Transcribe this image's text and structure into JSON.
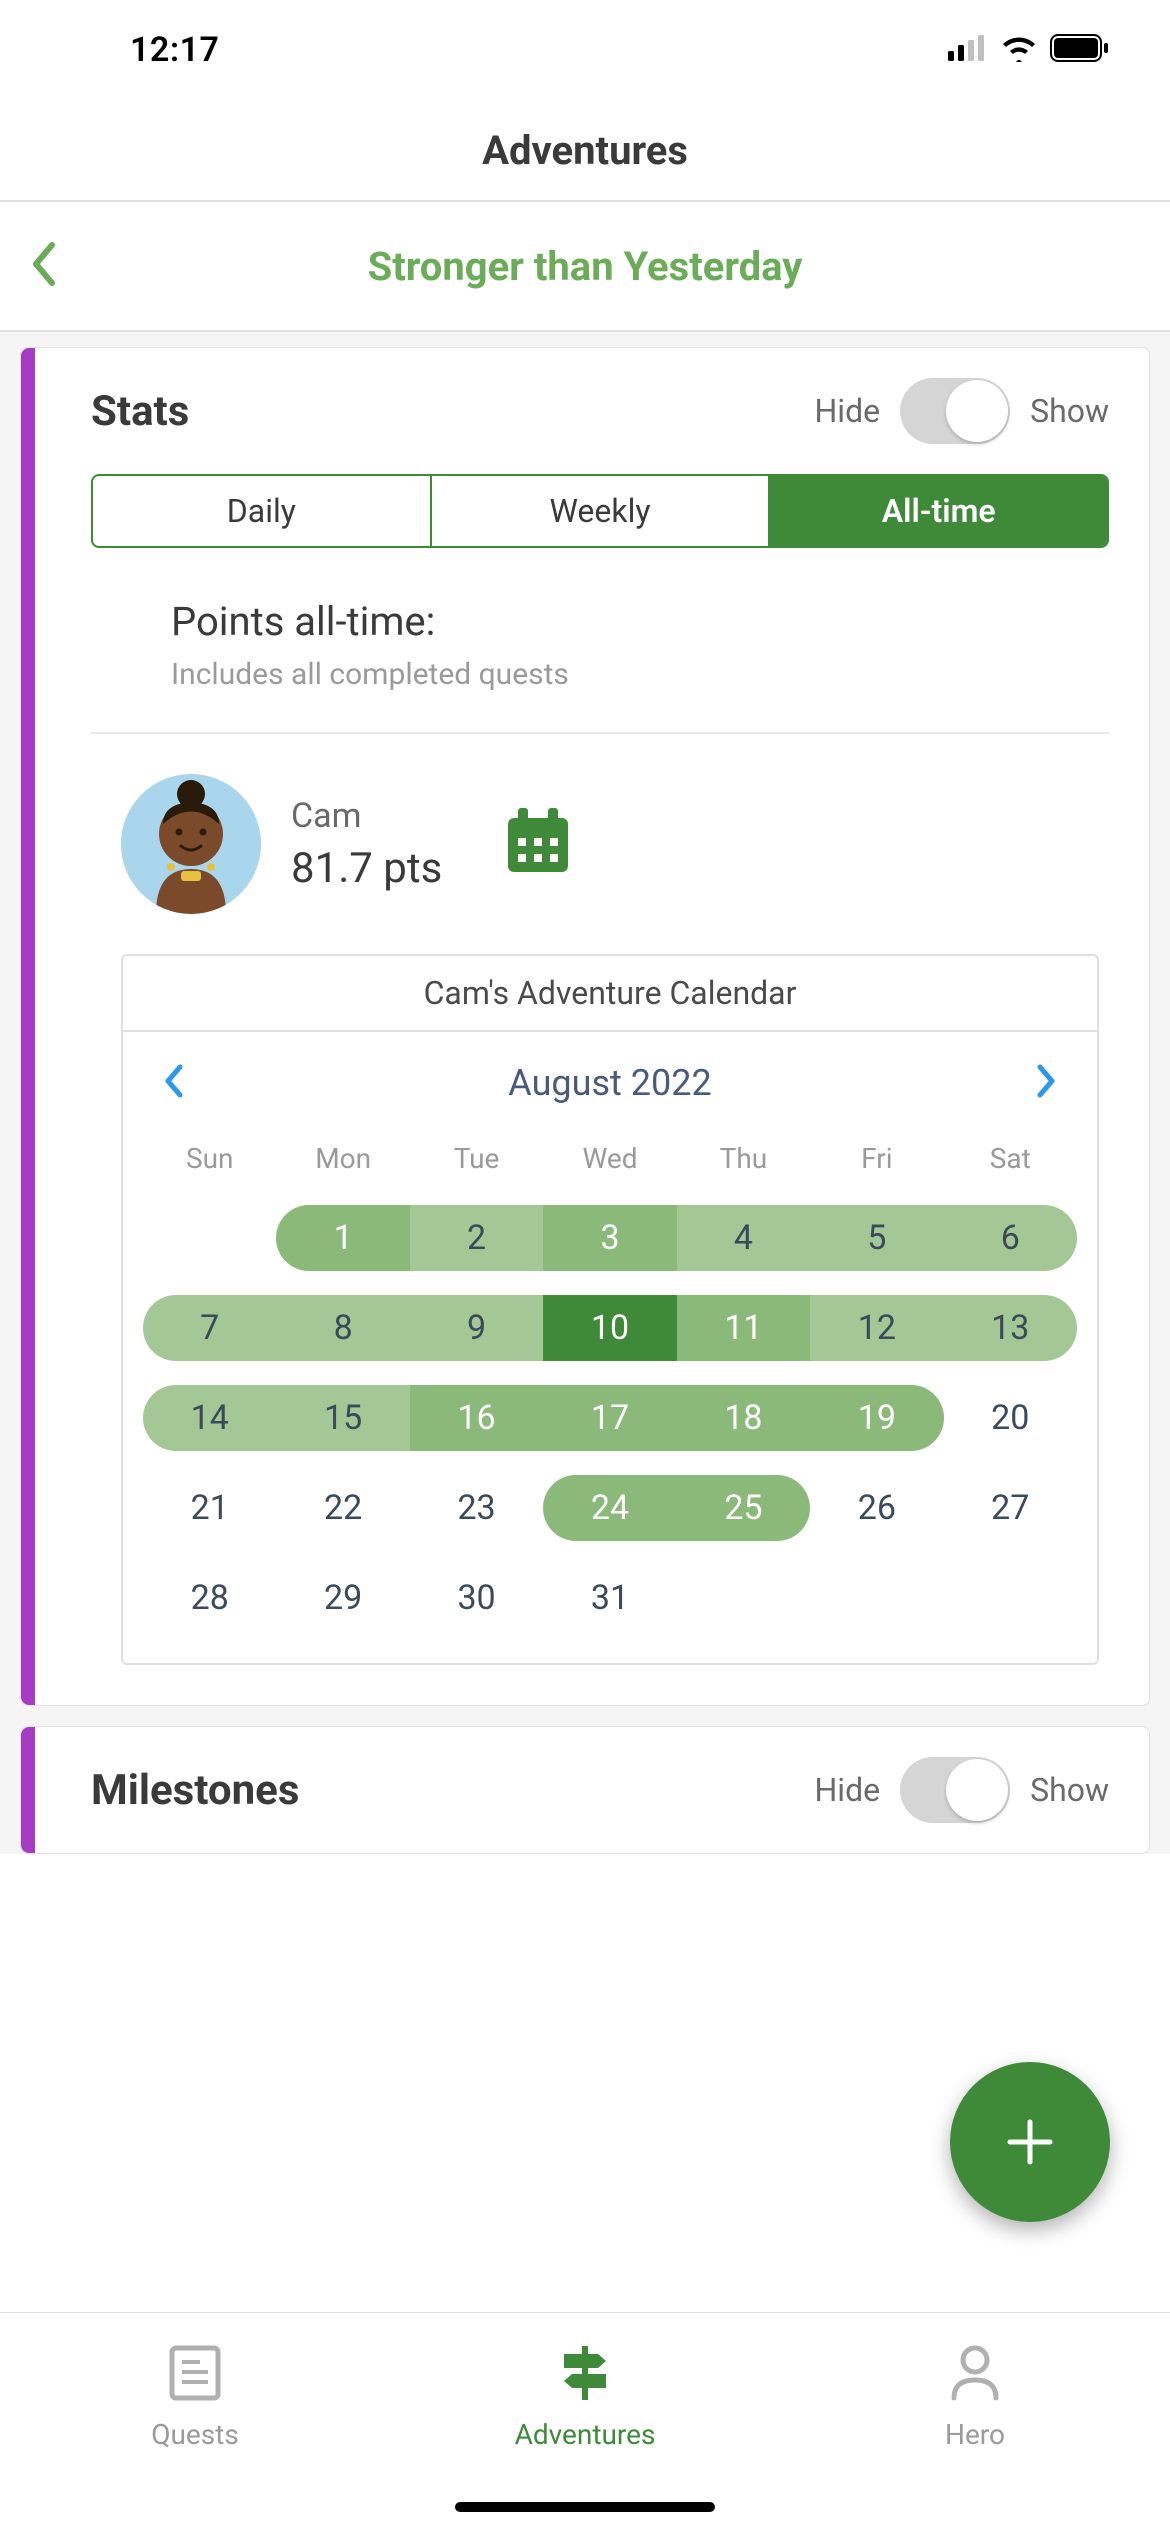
{
  "status": {
    "time": "12:17"
  },
  "header": {
    "title": "Adventures",
    "subtitle": "Stronger than Yesterday"
  },
  "stats": {
    "section_title": "Stats",
    "hide_label": "Hide",
    "show_label": "Show",
    "toggle_on": true,
    "segments": {
      "daily": "Daily",
      "weekly": "Weekly",
      "alltime": "All-time",
      "active": "alltime"
    },
    "points_title": "Points all-time:",
    "points_sub": "Includes all completed quests",
    "user": {
      "name": "Cam",
      "points": "81.7 pts"
    },
    "calendar": {
      "title": "Cam's Adventure Calendar",
      "month": "August 2022",
      "dow": [
        "Sun",
        "Mon",
        "Tue",
        "Wed",
        "Thu",
        "Fri",
        "Sat"
      ],
      "days": [
        {
          "n": "",
          "shade": ""
        },
        {
          "n": "1",
          "shade": "mid",
          "cap": "start",
          "on": true
        },
        {
          "n": "2",
          "shade": "mid-light"
        },
        {
          "n": "3",
          "shade": "mid",
          "on": true
        },
        {
          "n": "4",
          "shade": "mid-light"
        },
        {
          "n": "5",
          "shade": "mid-light"
        },
        {
          "n": "6",
          "shade": "mid-light",
          "cap": "end"
        },
        {
          "n": "7",
          "shade": "mid-light",
          "cap": "start"
        },
        {
          "n": "8",
          "shade": "mid-light"
        },
        {
          "n": "9",
          "shade": "mid-light"
        },
        {
          "n": "10",
          "shade": "dark",
          "on": true
        },
        {
          "n": "11",
          "shade": "mid",
          "on": true
        },
        {
          "n": "12",
          "shade": "mid-light"
        },
        {
          "n": "13",
          "shade": "mid-light",
          "cap": "end"
        },
        {
          "n": "14",
          "shade": "mid-light",
          "cap": "start"
        },
        {
          "n": "15",
          "shade": "mid-light"
        },
        {
          "n": "16",
          "shade": "mid",
          "on": true
        },
        {
          "n": "17",
          "shade": "mid",
          "on": true
        },
        {
          "n": "18",
          "shade": "mid",
          "on": true
        },
        {
          "n": "19",
          "shade": "mid",
          "cap": "end",
          "on": true
        },
        {
          "n": "20",
          "shade": ""
        },
        {
          "n": "21",
          "shade": ""
        },
        {
          "n": "22",
          "shade": ""
        },
        {
          "n": "23",
          "shade": ""
        },
        {
          "n": "24",
          "shade": "mid",
          "cap": "start",
          "on": true
        },
        {
          "n": "25",
          "shade": "mid",
          "cap": "end",
          "on": true
        },
        {
          "n": "26",
          "shade": ""
        },
        {
          "n": "27",
          "shade": ""
        },
        {
          "n": "28",
          "shade": ""
        },
        {
          "n": "29",
          "shade": ""
        },
        {
          "n": "30",
          "shade": ""
        },
        {
          "n": "31",
          "shade": ""
        },
        {
          "n": "",
          "shade": ""
        },
        {
          "n": "",
          "shade": ""
        },
        {
          "n": "",
          "shade": ""
        }
      ]
    }
  },
  "milestones": {
    "section_title": "Milestones",
    "hide_label": "Hide",
    "show_label": "Show"
  },
  "tabbar": {
    "quests": "Quests",
    "adventures": "Adventures",
    "hero": "Hero",
    "active": "adventures"
  },
  "colors": {
    "green": "#3e8a39",
    "accent_purple": "#a63bc4"
  }
}
